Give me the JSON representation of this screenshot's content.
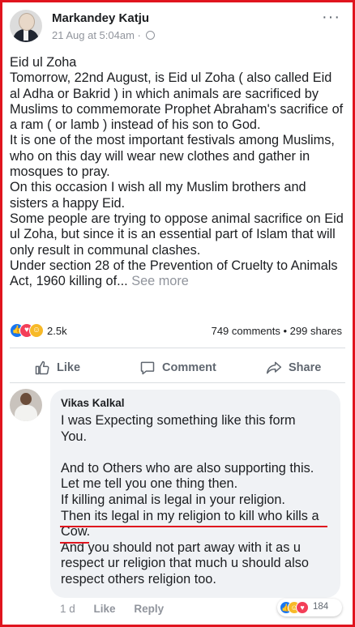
{
  "post": {
    "author": "Markandey Katju",
    "time": "21 Aug at 5:04am",
    "meta_separator": "·",
    "more_label": "···",
    "lines": [
      "Eid ul Zoha",
      "Tomorrow, 22nd August, is Eid ul Zoha ( also called Eid al Adha or Bakrid ) in which animals are sacrificed by Muslims to commemorate Prophet Abraham's sacrifice of a ram ( or lamb ) instead of his son to God.",
      "It is one of the most important festivals among Muslims, who on this day will wear new clothes and gather in mosques to pray.",
      "On this occasion I wish all my Muslim brothers and sisters a happy Eid.",
      "Some people are trying to oppose animal sacrifice on Eid ul Zoha, but since it is an essential part of Islam that will only result in communal clashes."
    ],
    "last_line": "Under section 28 of the Prevention of Cruelty to Animals Act, 1960 killing of...",
    "see_more": "See more"
  },
  "stats": {
    "reactions": "2.5k",
    "comments": "749 comments",
    "separator": "•",
    "shares": "299 shares"
  },
  "actions": {
    "like": "Like",
    "comment": "Comment",
    "share": "Share"
  },
  "comment": {
    "author": "Vikas Kalkal",
    "lines_a": [
      "I was Expecting something like this form",
      "You."
    ],
    "lines_b": [
      "And to Others who are also supporting this.",
      "Let me tell you one thing then.",
      "If killing animal is legal in your religion."
    ],
    "highlight_1": "Then its legal in my religion to kill who kills a",
    "highlight_2": "Cow.",
    "lines_c": [
      "And you should not part away with it as u",
      "respect ur religion that much u should also",
      "respect others religion too."
    ],
    "time": "1 d",
    "like": "Like",
    "reply": "Reply",
    "reaction_count": "184"
  },
  "colors": {
    "frame": "#e0141e",
    "like_blue": "#1877f2",
    "love_red": "#f33e58",
    "haha_yellow": "#f7b928"
  },
  "icons": [
    "more-icon",
    "globe-icon",
    "like-icon",
    "comment-icon",
    "share-icon",
    "like-reaction-icon",
    "love-reaction-icon",
    "haha-reaction-icon"
  ]
}
